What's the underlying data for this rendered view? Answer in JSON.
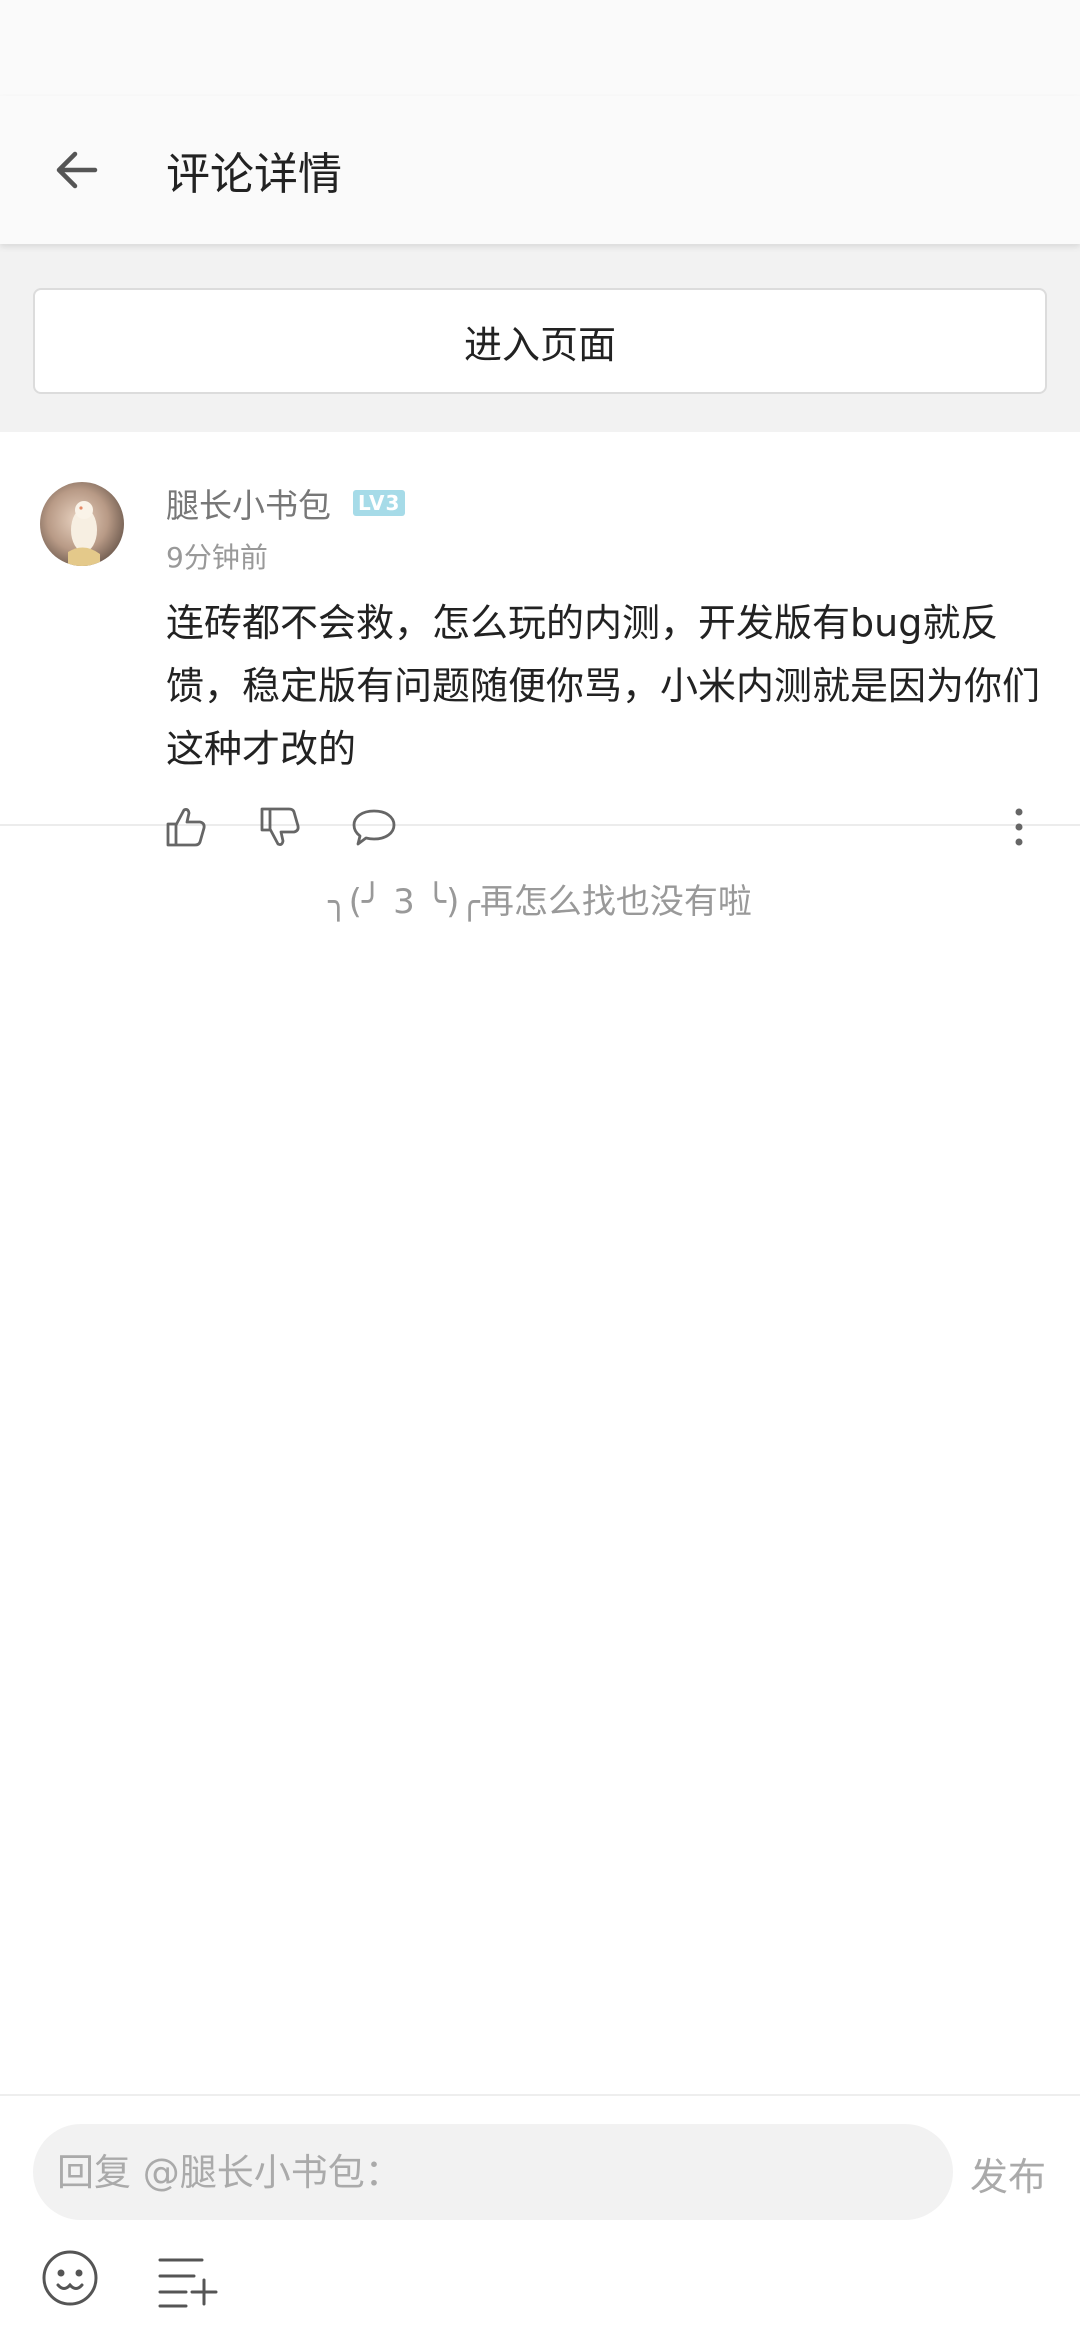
{
  "header": {
    "title": "评论详情"
  },
  "enter_page": {
    "label": "进入页面"
  },
  "comment": {
    "username": "腿长小书包",
    "level": "LV3",
    "timestamp": "9分钟前",
    "text": "连砖都不会救，怎么玩的内测，开发版有bug就反馈，稳定版有问题随便你骂，小米内测就是因为你们这种才改的",
    "level_badge_color": "#a6dbe8"
  },
  "end_message": "╮(╯ 3 ╰)╭再怎么找也没有啦",
  "reply": {
    "placeholder": "回复 @腿长小书包：",
    "publish_label": "发布"
  },
  "icons": {
    "back": "arrow-left-icon",
    "like": "thumbs-up-icon",
    "dislike": "thumbs-down-icon",
    "comment": "speech-bubble-icon",
    "more": "more-vertical-icon",
    "emoji": "emoji-icon",
    "format": "list-add-icon"
  }
}
